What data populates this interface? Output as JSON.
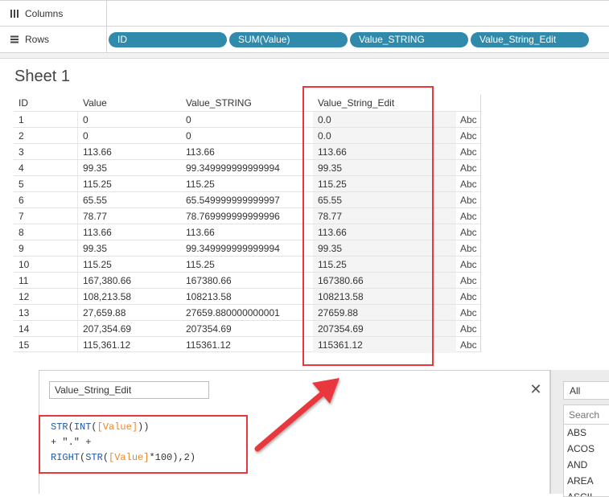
{
  "shelves": {
    "columns": {
      "label": "Columns",
      "icon": "columns-icon",
      "pills": []
    },
    "rows": {
      "label": "Rows",
      "icon": "rows-icon",
      "pills": [
        "ID",
        "SUM(Value)",
        "Value_STRING",
        "Value_String_Edit"
      ]
    }
  },
  "sheet": {
    "title": "Sheet 1"
  },
  "table": {
    "headers": {
      "id": "ID",
      "value": "Value",
      "value_string": "Value_STRING",
      "value_string_edit": "Value_String_Edit"
    },
    "rows": [
      {
        "id": "1",
        "value": "0",
        "value_string": "0",
        "edit": "0.0",
        "type": "Abc"
      },
      {
        "id": "2",
        "value": "0",
        "value_string": "0",
        "edit": "0.0",
        "type": "Abc"
      },
      {
        "id": "3",
        "value": "113.66",
        "value_string": "113.66",
        "edit": "113.66",
        "type": "Abc"
      },
      {
        "id": "4",
        "value": "99.35",
        "value_string": "99.349999999999994",
        "edit": "99.35",
        "type": "Abc"
      },
      {
        "id": "5",
        "value": "115.25",
        "value_string": "115.25",
        "edit": "115.25",
        "type": "Abc"
      },
      {
        "id": "6",
        "value": "65.55",
        "value_string": "65.549999999999997",
        "edit": "65.55",
        "type": "Abc"
      },
      {
        "id": "7",
        "value": "78.77",
        "value_string": "78.769999999999996",
        "edit": "78.77",
        "type": "Abc"
      },
      {
        "id": "8",
        "value": "113.66",
        "value_string": "113.66",
        "edit": "113.66",
        "type": "Abc"
      },
      {
        "id": "9",
        "value": "99.35",
        "value_string": "99.349999999999994",
        "edit": "99.35",
        "type": "Abc"
      },
      {
        "id": "10",
        "value": "115.25",
        "value_string": "115.25",
        "edit": "115.25",
        "type": "Abc"
      },
      {
        "id": "11",
        "value": "167,380.66",
        "value_string": "167380.66",
        "edit": "167380.66",
        "type": "Abc"
      },
      {
        "id": "12",
        "value": "108,213.58",
        "value_string": "108213.58",
        "edit": "108213.58",
        "type": "Abc"
      },
      {
        "id": "13",
        "value": "27,659.88",
        "value_string": "27659.880000000001",
        "edit": "27659.88",
        "type": "Abc"
      },
      {
        "id": "14",
        "value": "207,354.69",
        "value_string": "207354.69",
        "edit": "207354.69",
        "type": "Abc"
      },
      {
        "id": "15",
        "value": "115,361.12",
        "value_string": "115361.12",
        "edit": "115361.12",
        "type": "Abc"
      }
    ]
  },
  "calc_editor": {
    "name": "Value_String_Edit",
    "close_icon": "close-icon",
    "formula": {
      "line1": {
        "fn1": "STR",
        "p1": "(",
        "fn2": "INT",
        "p2": "(",
        "field": "[Value]",
        "p3": "))"
      },
      "line2": {
        "text": "+ \".\" +"
      },
      "line3": {
        "fn1": "RIGHT",
        "p1": "(",
        "fn2": "STR",
        "p2": "(",
        "field": "[Value]",
        "p3": "*100),2)"
      }
    }
  },
  "function_panel": {
    "category": "All",
    "search_placeholder": "Search",
    "functions": [
      "ABS",
      "ACOS",
      "AND",
      "AREA",
      "ASCII"
    ]
  },
  "colors": {
    "pill": "#2f8aab",
    "highlight": "#e8383d",
    "function": "#1f5aa8",
    "field": "#e7892f"
  }
}
